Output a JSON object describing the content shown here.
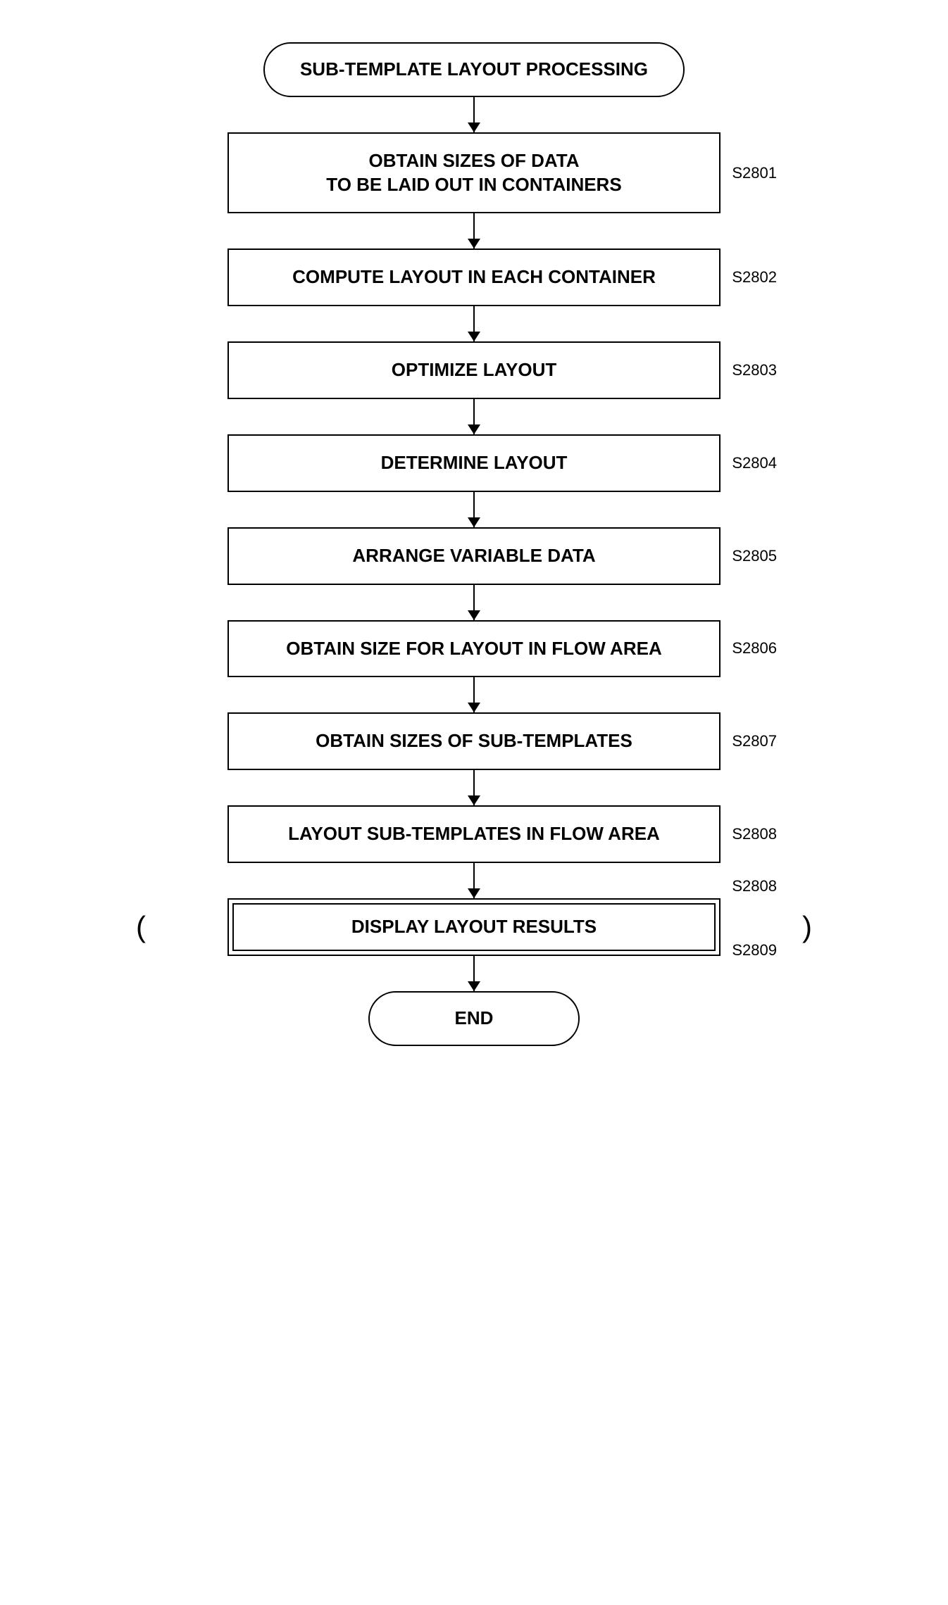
{
  "flowchart": {
    "title": "SUB-TEMPLATE LAYOUT PROCESSING",
    "end_label": "END",
    "steps": [
      {
        "id": "s2801",
        "label": "S2801",
        "text": "OBTAIN SIZES OF DATA\nTO BE LAID OUT IN CONTAINERS",
        "type": "process"
      },
      {
        "id": "s2802",
        "label": "S2802",
        "text": "COMPUTE LAYOUT IN EACH CONTAINER",
        "type": "process"
      },
      {
        "id": "s2803",
        "label": "S2803",
        "text": "OPTIMIZE LAYOUT",
        "type": "process"
      },
      {
        "id": "s2804",
        "label": "S2804",
        "text": "DETERMINE LAYOUT",
        "type": "process"
      },
      {
        "id": "s2805",
        "label": "S2805",
        "text": "ARRANGE VARIABLE DATA",
        "type": "process"
      },
      {
        "id": "s2806",
        "label": "S2806",
        "text": "OBTAIN SIZE FOR LAYOUT IN FLOW AREA",
        "type": "process"
      },
      {
        "id": "s2807",
        "label": "S2807",
        "text": "OBTAIN SIZES OF SUB-TEMPLATES",
        "type": "process"
      },
      {
        "id": "s2808",
        "label": "S2808",
        "text": "LAYOUT SUB-TEMPLATES IN FLOW AREA",
        "type": "process"
      },
      {
        "id": "s2809",
        "label": "S2809",
        "text": "DISPLAY LAYOUT RESULTS",
        "type": "process-double",
        "has_connectors": true
      }
    ]
  }
}
